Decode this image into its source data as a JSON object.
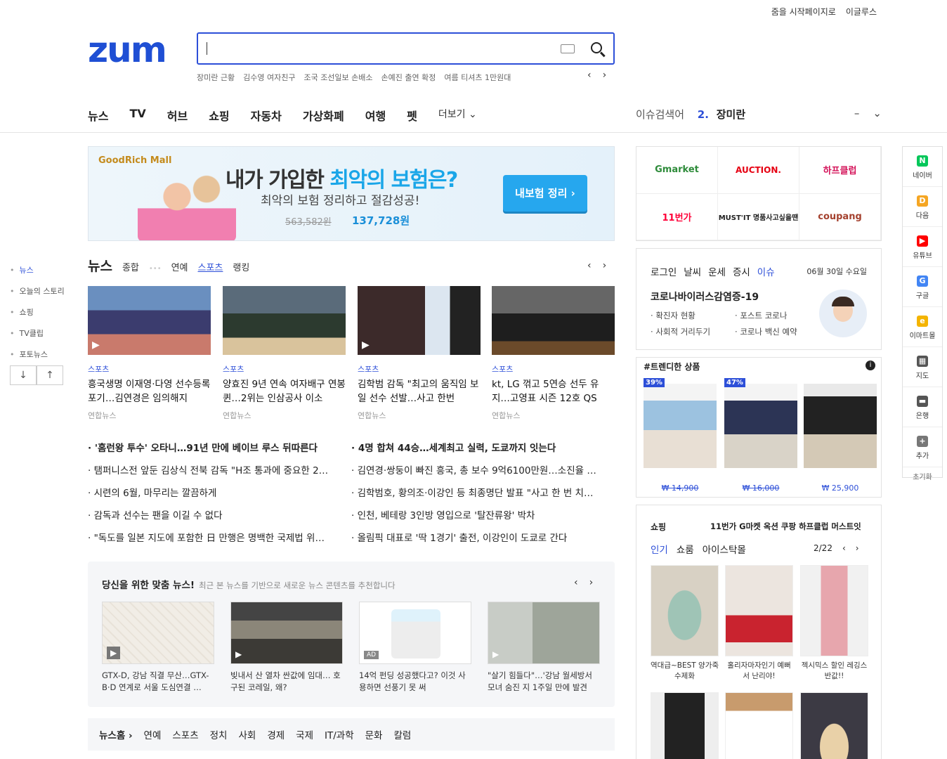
{
  "header": {
    "top_links": [
      "줌을 시작페이지로",
      "이글루스"
    ],
    "logo": "zum",
    "search_value": "",
    "keywords": [
      "장미란 근황",
      "김수영 여자친구",
      "조국 조선일보 손배소",
      "손예진 출연 확정",
      "여름 티셔츠 1만원대"
    ],
    "prev": "‹",
    "next": "›"
  },
  "gnb": {
    "items": [
      "뉴스",
      "TV",
      "허브",
      "쇼핑",
      "자동차",
      "가상화폐",
      "여행",
      "펫"
    ],
    "more": "더보기 ⌄"
  },
  "issue": {
    "label": "이슈검색어",
    "rank": "2.",
    "keyword": "장미란",
    "trend": "–",
    "toggle": "⌄"
  },
  "banner": {
    "brand": "GoodRich Mall",
    "headline_a": "내가 가입한 ",
    "headline_b": "최악의 보험은?",
    "sub": "최악의 보험 정리하고 절감성공!",
    "old_price": "563,582원",
    "new_price": "137,728원",
    "button": "내보험 정리 ›"
  },
  "sidenav": {
    "items": [
      "뉴스",
      "오늘의 스토리",
      "쇼핑",
      "TV클립",
      "포토뉴스"
    ],
    "down": "↓",
    "up": "↑"
  },
  "news": {
    "title": "뉴스",
    "tabs": [
      "종합",
      "연예",
      "스포츠",
      "랭킹"
    ],
    "cards": [
      {
        "cat": "스포츠",
        "title": "흥국생명 이재영·다영 선수등록 포기…김연경은 임의해지",
        "src": "연합뉴스"
      },
      {
        "cat": "스포츠",
        "title": "양효진 9년 연속 여자배구 연봉퀸…2위는 인삼공사 이소",
        "src": "연합뉴스"
      },
      {
        "cat": "스포츠",
        "title": "김학범 감독 \"최고의 움직임 보일 선수 선발…사고 한번",
        "src": "연합뉴스"
      },
      {
        "cat": "스포츠",
        "title": "kt, LG 꺾고 5연승 선두 유지…고영표 시즌 12호 QS",
        "src": "연합뉴스"
      }
    ],
    "left_list": [
      "· '홈런왕 투수' 오타니…91년 만에 베이브 루스 뒤따른다",
      "· 탬퍼니스전 앞둔 김상식 전북 감독 \"H조 통과에 중요한 2…",
      "· 시련의 6월, 마무리는 깔끔하게",
      "· 감독과 선수는 팬을 이길 수 없다",
      "· \"독도를 일본 지도에 포함한 日 만행은 명백한 국제법 위…"
    ],
    "right_list": [
      "· 4명 합쳐 44승…세계최고 실력, 도쿄까지 잇는다",
      "· 김연경·쌍둥이 빠진 흥국, 총 보수 9억6100만원…소진율 …",
      "· 김학범호, 황의조·이강인 등 최종명단 발표 \"사고 한 번 치…",
      "· 인천, 베테랑 3인방 영입으로 '탈잔류왕' 박차",
      "· 올림픽 대표로 '딱 1경기' 출전, 이강인이 도쿄로 간다"
    ]
  },
  "reco": {
    "title": "당신을 위한 맞춤 뉴스!",
    "desc": "최근 본 뉴스를 기반으로 새로운 뉴스 콘텐츠를 추천합니다",
    "items": [
      {
        "title": "GTX-D, 강남 직결 무산…GTX-B·D 연계로 서울 도심연결 …"
      },
      {
        "title": "빚내서 산 열차 싼값에 임대… 호구된 코레일, 왜?"
      },
      {
        "title": "14억 펀딩 성공했다고? 이것 사용하면 선풍기 못 써",
        "ad": "AD"
      },
      {
        "title": "\"살기 힘들다\"…'강남 월세방서 모녀 숨진 지 1주일 만에 발견"
      }
    ]
  },
  "newsfoot": {
    "home": "뉴스홈 ›",
    "items": [
      "연예",
      "스포츠",
      "정치",
      "사회",
      "경제",
      "국제",
      "IT/과학",
      "문화",
      "칼럼"
    ]
  },
  "shops": [
    "Gmarket",
    "AUCTION.",
    "하프클럽",
    "11번가",
    "MUST'IT 명품사고싶을땐",
    "coupang"
  ],
  "info": {
    "tabs": [
      "로그인",
      "날씨",
      "운세",
      "증시",
      "이슈"
    ],
    "date": "06월 30일 수요일",
    "topic": "코로나바이러스감염증-19",
    "links": [
      "확진자 현황",
      "포스트 코로나",
      "사회적 거리두기",
      "코로나 백신 예약"
    ]
  },
  "trend": {
    "title": "#트렌디한 상품",
    "info": "i",
    "items": [
      {
        "badge": "39%",
        "price": "₩ 14,900"
      },
      {
        "badge": "47%",
        "price": "₩ 16,000"
      },
      {
        "badge": "",
        "price": "₩ 25,900"
      }
    ]
  },
  "shopping": {
    "title": "쇼핑",
    "marquee": "11번가 G마켓 옥션 쿠팡 하프클럽 머스트잇",
    "tabs": [
      "인기",
      "쇼룸",
      "아이스탁몰"
    ],
    "page": "2/22",
    "items": [
      "역대급~BEST 양가죽 수제화",
      "홀리자마자인기 예뻐서 난리야!",
      "젝시믹스 할인 레깅스 반값!!"
    ]
  },
  "rail": {
    "items": [
      {
        "label": "네이버",
        "icon": "N",
        "color": "#03c75a"
      },
      {
        "label": "다음",
        "icon": "D",
        "color": "#f5a623"
      },
      {
        "label": "유튜브",
        "icon": "▶",
        "color": "#ff0000"
      },
      {
        "label": "구글",
        "icon": "G",
        "color": "#4285f4"
      },
      {
        "label": "이마트몰",
        "icon": "e",
        "color": "#f4b400"
      },
      {
        "label": "지도",
        "icon": "▦",
        "color": "#555"
      },
      {
        "label": "은행",
        "icon": "▬",
        "color": "#555"
      },
      {
        "label": "추가",
        "icon": "+",
        "color": "#777"
      }
    ],
    "reset": "초기화"
  }
}
